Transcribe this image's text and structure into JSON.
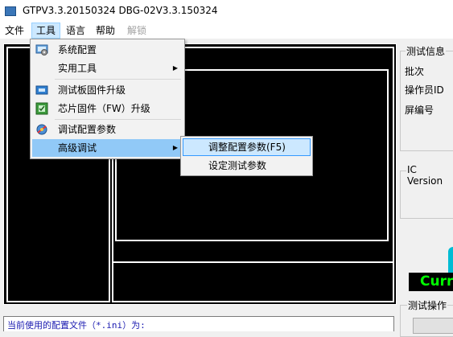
{
  "window": {
    "title": "GTPV3.3.20150324  DBG-02V3.3.150324"
  },
  "menubar": {
    "items": [
      {
        "label": "文件"
      },
      {
        "label": "工具"
      },
      {
        "label": "语言"
      },
      {
        "label": "帮助"
      },
      {
        "label": "解锁"
      }
    ]
  },
  "tools_menu": {
    "items": [
      {
        "label": "系统配置",
        "icon": "settings-icon"
      },
      {
        "label": "实用工具",
        "icon": ""
      },
      {
        "label": "测试板固件升级",
        "icon": "board-icon"
      },
      {
        "label": "芯片固件（FW）升级",
        "icon": "chip-icon"
      },
      {
        "label": "调试配置参数",
        "icon": "debug-icon"
      },
      {
        "label": "高级调试",
        "icon": ""
      }
    ],
    "submenu_arrow": "▶"
  },
  "advanced_submenu": {
    "items": [
      {
        "label": "调整配置参数(F5)"
      },
      {
        "label": "设定测试参数"
      }
    ]
  },
  "right_panel": {
    "test_info_title": "测试信息",
    "batch_label": "批次",
    "operator_label": "操作员ID",
    "screen_no_label": "屏编号",
    "ic_version_title": "IC Version",
    "current_banner": "Curr",
    "test_operation_title": "测试操作"
  },
  "status": {
    "config_file_line": "当前使用的配置文件（*.ini）为:"
  },
  "colors": {
    "menu_highlight": "#91c9f7",
    "submenu_highlight": "#cce8ff",
    "banner_text": "#00ff00",
    "indicator": "#00bcd4"
  }
}
